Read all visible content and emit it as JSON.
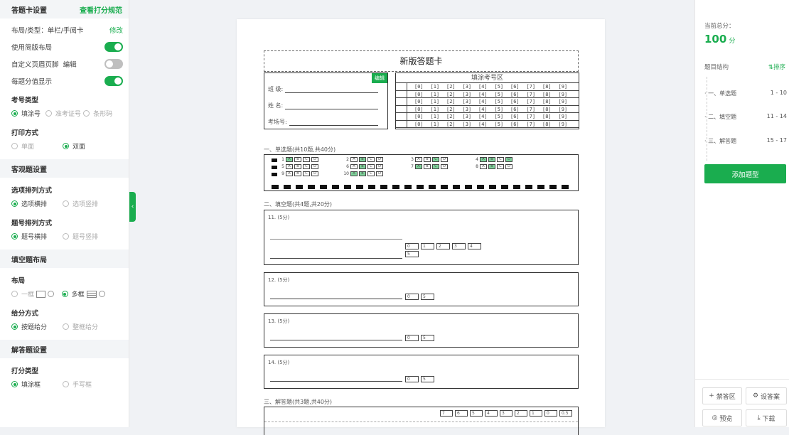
{
  "left": {
    "header_title": "答题卡设置",
    "header_link": "查看打分规范",
    "layout_label": "布局/类型：单栏/手阅卡",
    "layout_link": "修改",
    "toggles": [
      {
        "label": "使用简版布局",
        "on": true
      },
      {
        "label": "自定义页眉页脚",
        "extra": "编辑",
        "on": false
      },
      {
        "label": "每题分值显示",
        "on": true
      }
    ],
    "exam_type": {
      "label": "考号类型",
      "options": [
        "填涂号",
        "准考证号",
        "条形码"
      ]
    },
    "print_mode": {
      "label": "打印方式",
      "options": [
        "单面",
        "双面"
      ]
    },
    "objective": {
      "title": "客观题设置",
      "option_order": {
        "label": "选项排列方式",
        "options": [
          "选项横排",
          "选项竖排"
        ]
      },
      "number_order": {
        "label": "题号排列方式",
        "options": [
          "题号横排",
          "题号竖排"
        ]
      }
    },
    "fill": {
      "title": "填空题布局",
      "layout": {
        "label": "布局",
        "options": [
          "一框",
          "多框"
        ]
      },
      "scoring": {
        "label": "给分方式",
        "options": [
          "按题给分",
          "整框给分"
        ]
      }
    },
    "answer": {
      "title": "解答题设置",
      "score_type": {
        "label": "打分类型",
        "options": [
          "填涂框",
          "手写框"
        ]
      }
    }
  },
  "collapse_icon": "‹",
  "paper": {
    "title": "新版答题卡",
    "edit_badge": "编辑",
    "fields": [
      "班 级:",
      "姓 名:",
      "考场号:"
    ],
    "fill_zone_title": "填涂考号区",
    "digits": [
      "0",
      "1",
      "2",
      "3",
      "4",
      "5",
      "6",
      "7",
      "8",
      "9"
    ],
    "section1": "一、单选题(共10题,共40分)",
    "mc_numbers": [
      "1",
      "2",
      "3",
      "4",
      "5",
      "6",
      "7",
      "8",
      "9",
      "10"
    ],
    "mc_letters": [
      "A",
      "B",
      "C",
      "D"
    ],
    "section2": "二、填空题(共4题,共20分)",
    "blank_questions": [
      {
        "label": "11. (5分)",
        "scores": [
          "0",
          "1",
          "2",
          "3",
          "4",
          "5"
        ]
      },
      {
        "label": "12. (5分)",
        "scores": [
          "0",
          "5"
        ]
      },
      {
        "label": "13. (5分)",
        "scores": [
          "0",
          "5"
        ]
      },
      {
        "label": "14. (5分)",
        "scores": [
          "0",
          "5"
        ]
      }
    ],
    "section3": "三、解答题(共3题,共40分)",
    "answer_scores": [
      "7",
      "6",
      "5",
      "4",
      "3",
      "2",
      "1",
      "0",
      "0.5"
    ]
  },
  "right": {
    "total_label": "当前总分：",
    "total_value": "100",
    "total_unit": "分",
    "structure_label": "题目结构",
    "sort_label": "排序",
    "sort_icon": "sort-icon",
    "items": [
      {
        "name": "一、单选题",
        "range": "1 - 10"
      },
      {
        "name": "二、填空题",
        "range": "11 - 14"
      },
      {
        "name": "三、解答题",
        "range": "15 - 17"
      }
    ],
    "add_button": "添加题型",
    "footer": [
      {
        "icon": "+",
        "label": "禁答区"
      },
      {
        "icon": "⚙",
        "label": "设答案"
      },
      {
        "icon": "◎",
        "label": "预览"
      },
      {
        "icon": "⤓",
        "label": "下载"
      }
    ]
  },
  "colors": {
    "accent": "#1aad4f"
  }
}
